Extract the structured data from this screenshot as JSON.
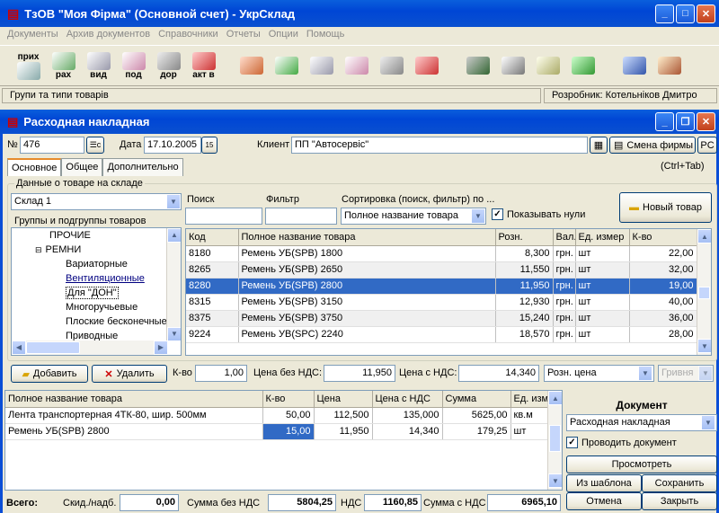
{
  "app": {
    "title": "ТзОВ \"Моя Фірма\" (Основной счет) - УкрСклад"
  },
  "menu": [
    "Документы",
    "Архив документов",
    "Справочники",
    "Отчеты",
    "Опции",
    "Помощь"
  ],
  "toolbar": {
    "group1": [
      {
        "label": "прих",
        "icon": "incoming-icon"
      },
      {
        "label": "рах",
        "icon": "invoice-icon"
      },
      {
        "label": "вид",
        "icon": "outgoing-icon"
      },
      {
        "label": "под",
        "icon": "tax-invoice-icon"
      },
      {
        "label": "дор",
        "icon": "power-of-attorney-icon"
      },
      {
        "label": "акт в",
        "icon": "act-icon"
      }
    ],
    "group2": [
      "payment-icon",
      "edit-icon",
      "document-icon",
      "document2-icon",
      "scroll-icon",
      "stamp-icon"
    ],
    "group3": [
      "users-icon",
      "cards-icon",
      "report-icon",
      "money-icon"
    ],
    "group4": [
      "tools-icon",
      "home-icon"
    ]
  },
  "statusbar": {
    "left": "Групи та типи товарів",
    "right": "Розробник: Котельніков Дмитро"
  },
  "doc": {
    "title": "Расходная накладная",
    "number_label": "№",
    "number": "476",
    "date_label": "Дата",
    "date": "17.10.2005",
    "client_label": "Клиент",
    "client": "ПП \"Автосервіс\"",
    "change_company": "Смена фирмы",
    "pc": "PC",
    "ctrl_tab": "(Ctrl+Tab)",
    "tabs": [
      "Основное",
      "Общее",
      "Дополнительно"
    ],
    "group_title": "Данные о товаре на складе",
    "warehouse": "Склад 1",
    "tree_title": "Группы и подгруппы товаров",
    "tree": [
      "ПРОЧИЕ",
      "РЕМНИ",
      "Вариаторные",
      "Вентиляционные",
      "Для \"ДОН\"",
      "Многоручьевые",
      "Плоские бесконечные",
      "Приводные"
    ],
    "search_label": "Поиск",
    "filter_label": "Фильтр",
    "sort_label": "Сортировка (поиск, фильтр) по ...",
    "sort_value": "Полное название товара",
    "show_zero": "Показывать нули",
    "new_item": "Новый товар",
    "columns": [
      "Код",
      "Полное название товара",
      "Розн.",
      "Вал.",
      "Ед. измер",
      "К-во"
    ],
    "rows": [
      [
        "8180",
        "Ремень УБ(SPB) 1800",
        "8,300",
        "грн.",
        "шт",
        "22,00"
      ],
      [
        "8265",
        "Ремень УБ(SPB) 2650",
        "11,550",
        "грн.",
        "шт",
        "32,00"
      ],
      [
        "8280",
        "Ремень УБ(SPB) 2800",
        "11,950",
        "грн.",
        "шт",
        "19,00"
      ],
      [
        "8315",
        "Ремень УБ(SPB) 3150",
        "12,930",
        "грн.",
        "шт",
        "40,00"
      ],
      [
        "8375",
        "Ремень УБ(SPB) 3750",
        "15,240",
        "грн.",
        "шт",
        "36,00"
      ],
      [
        "9224",
        "Ремень УВ(SPC) 2240",
        "18,570",
        "грн.",
        "шт",
        "28,00"
      ]
    ],
    "add": "Добавить",
    "delete": "Удалить",
    "qty_label": "К-во",
    "qty": "1,00",
    "price_novat_label": "Цена без НДС:",
    "price_novat": "11,950",
    "price_vat_label": "Цена с НДС:",
    "price_vat": "14,340",
    "price_type": "Розн. цена",
    "currency": "Гривня",
    "lines_columns": [
      "Полное название товара",
      "К-во",
      "Цена",
      "Цена с НДС",
      "Сумма",
      "Ед. изм"
    ],
    "lines": [
      [
        "Лента транспортерная 4ТК-80, шир. 500мм",
        "50,00",
        "112,500",
        "135,000",
        "5625,00",
        "кв.м"
      ],
      [
        "Ремень УБ(SPB) 2800",
        "15,00",
        "11,950",
        "14,340",
        "179,25",
        "шт"
      ]
    ],
    "document_label": "Документ",
    "document_type": "Расходная накладная",
    "post_doc": "Проводить документ",
    "btn_view": "Просмотреть",
    "btn_template": "Из шаблона",
    "btn_save": "Сохранить",
    "btn_cancel": "Отмена",
    "btn_close": "Закрыть",
    "total_label": "Всего:",
    "discount_label": "Скид./надб.",
    "discount": "0,00",
    "sum_novat_label": "Сумма без НДС",
    "sum_novat": "5804,25",
    "vat_label": "НДС",
    "vat": "1160,85",
    "sum_vat_label": "Сумма с НДС",
    "sum_vat": "6965,10"
  }
}
